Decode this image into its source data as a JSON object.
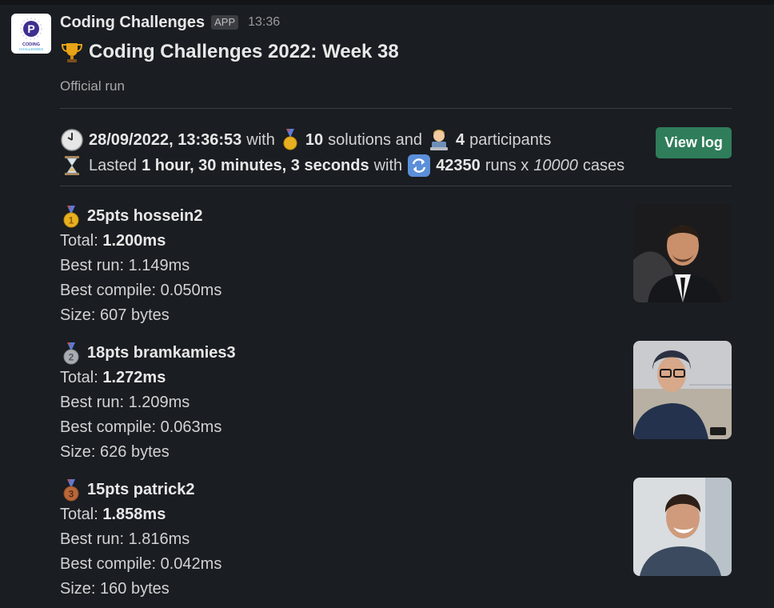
{
  "app": {
    "name": "Coding Challenges",
    "badge": "APP",
    "time": "13:36",
    "logo_text_1": "CODING",
    "logo_text_2": "CHALLENGES"
  },
  "message": {
    "title": "Coding Challenges 2022: Week 38",
    "title_icon": "trophy-icon",
    "subtitle": "Official run"
  },
  "summary": {
    "date": "28/09/2022, 13:36:53",
    "with1": "with",
    "solutions_count": "10",
    "solutions_label": "solutions and",
    "participants_count": "4",
    "participants_label": "participants",
    "lasted_label": "Lasted",
    "duration": "1 hour, 30 minutes, 3 seconds",
    "with2": "with",
    "runs": "42350",
    "runs_label": "runs x",
    "cases": "10000",
    "cases_label": "cases",
    "icons": [
      "clock-icon",
      "medal-icon",
      "technologist-icon",
      "hourglass-icon",
      "repeat-icon"
    ]
  },
  "actions": {
    "view_log": "View log"
  },
  "results": [
    {
      "rank_icon": "gold-medal-icon",
      "rank_number": "1",
      "headline": "25pts hossein2",
      "total_label": "Total:",
      "total": "1.200ms",
      "best_run": "Best run: 1.149ms",
      "best_compile": "Best compile: 0.050ms",
      "size": "Size: 607 bytes",
      "colors": {
        "medal": "#e8b020"
      }
    },
    {
      "rank_icon": "silver-medal-icon",
      "rank_number": "2",
      "headline": "18pts bramkamies3",
      "total_label": "Total:",
      "total": "1.272ms",
      "best_run": "Best run: 1.209ms",
      "best_compile": "Best compile: 0.063ms",
      "size": "Size: 626 bytes",
      "colors": {
        "medal": "#a9adb3"
      }
    },
    {
      "rank_icon": "bronze-medal-icon",
      "rank_number": "3",
      "headline": "15pts patrick2",
      "total_label": "Total:",
      "total": "1.858ms",
      "best_run": "Best run: 1.816ms",
      "best_compile": "Best compile: 0.042ms",
      "size": "Size: 160 bytes",
      "colors": {
        "medal": "#b8683a"
      }
    }
  ],
  "colors": {
    "background": "#1a1d21",
    "button": "#2f7d5a",
    "divider": "#3a3d42"
  }
}
